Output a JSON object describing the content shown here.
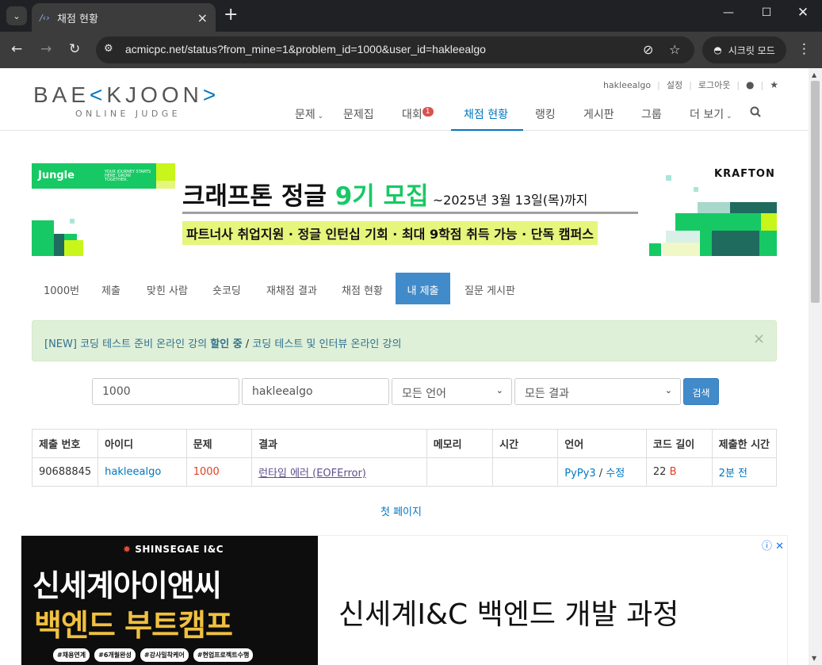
{
  "browser": {
    "tab_title": "채점 현황",
    "tab_favicon": "/‹›",
    "url": "acmicpc.net/status?from_mine=1&problem_id=1000&user_id=hakleealgo",
    "incognito_label": "시크릿 모드"
  },
  "site": {
    "logo_left": "BAE",
    "logo_mark": "K",
    "logo_right": "JOON",
    "logo_sub": "ONLINE JUDGE",
    "user": {
      "username": "hakleealgo",
      "settings": "설정",
      "logout": "로그아웃"
    },
    "nav": [
      {
        "label": "문제",
        "dropdown": true
      },
      {
        "label": "문제집"
      },
      {
        "label": "대회",
        "badge": "1"
      },
      {
        "label": "채점 현황",
        "active": true
      },
      {
        "label": "랭킹"
      },
      {
        "label": "게시판"
      },
      {
        "label": "그룹"
      },
      {
        "label": "더 보기",
        "dropdown": true
      }
    ]
  },
  "banner": {
    "tag": "Jungle",
    "tag_small": "YOUR JOURNEY STARTS HERE. GROW TOGETHER.",
    "title_prefix": "크래프톤 정글 ",
    "title_highlight": "9기 모집",
    "title_date": " ~2025년 3월 13일(목)까지",
    "subtitle": "파트너사 취업지원 · 정글 인턴십 기회 · 최대 9학점 취득 가능 · 단독 캠퍼스",
    "brand": "KRAFTON"
  },
  "problem_tabs": [
    {
      "label": "1000번"
    },
    {
      "label": "제출"
    },
    {
      "label": "맞힌 사람"
    },
    {
      "label": "숏코딩"
    },
    {
      "label": "재채점 결과"
    },
    {
      "label": "채점 현황"
    },
    {
      "label": "내 제출",
      "active": true
    },
    {
      "label": "질문 게시판"
    }
  ],
  "alert": {
    "prefix": "[NEW] 코딩 테스트 준비 온라인 강의 ",
    "bold": "할인 중",
    "slash": " / ",
    "suffix": "코딩 테스트 및 인터뷰 온라인 강의"
  },
  "filters": {
    "problem_id": "1000",
    "user_id": "hakleealgo",
    "language": "모든 언어",
    "result": "모든 결과",
    "search_button": "검색"
  },
  "table": {
    "headers": [
      "제출 번호",
      "아이디",
      "문제",
      "결과",
      "메모리",
      "시간",
      "언어",
      "코드 길이",
      "제출한 시간"
    ],
    "rows": [
      {
        "submission_id": "90688845",
        "user": "hakleealgo",
        "problem": "1000",
        "result": "런타임 에러 (EOFError)",
        "memory": "",
        "time": "",
        "language": "PyPy3",
        "lang_sep": " / ",
        "edit": "수정",
        "code_length": "22",
        "code_unit": "B",
        "submitted": "2분 전"
      }
    ]
  },
  "pagination": {
    "first": "첫 페이지"
  },
  "ad": {
    "logo": "SHINSEGAE I&C",
    "line1": "신세계아이앤씨",
    "line2": "백엔드 부트캠프",
    "tags": [
      "#채용연계",
      "#6개월완성",
      "#강사밀착케어",
      "#현업프로젝트수행"
    ],
    "headline": "신세계I&C 백엔드 개발 과정"
  },
  "colors": {
    "accent": "#0076c0",
    "active_tab": "#428bca",
    "alert_bg": "#dff0d8",
    "error_red": "#dd4124",
    "jungle_green": "#17c964"
  }
}
